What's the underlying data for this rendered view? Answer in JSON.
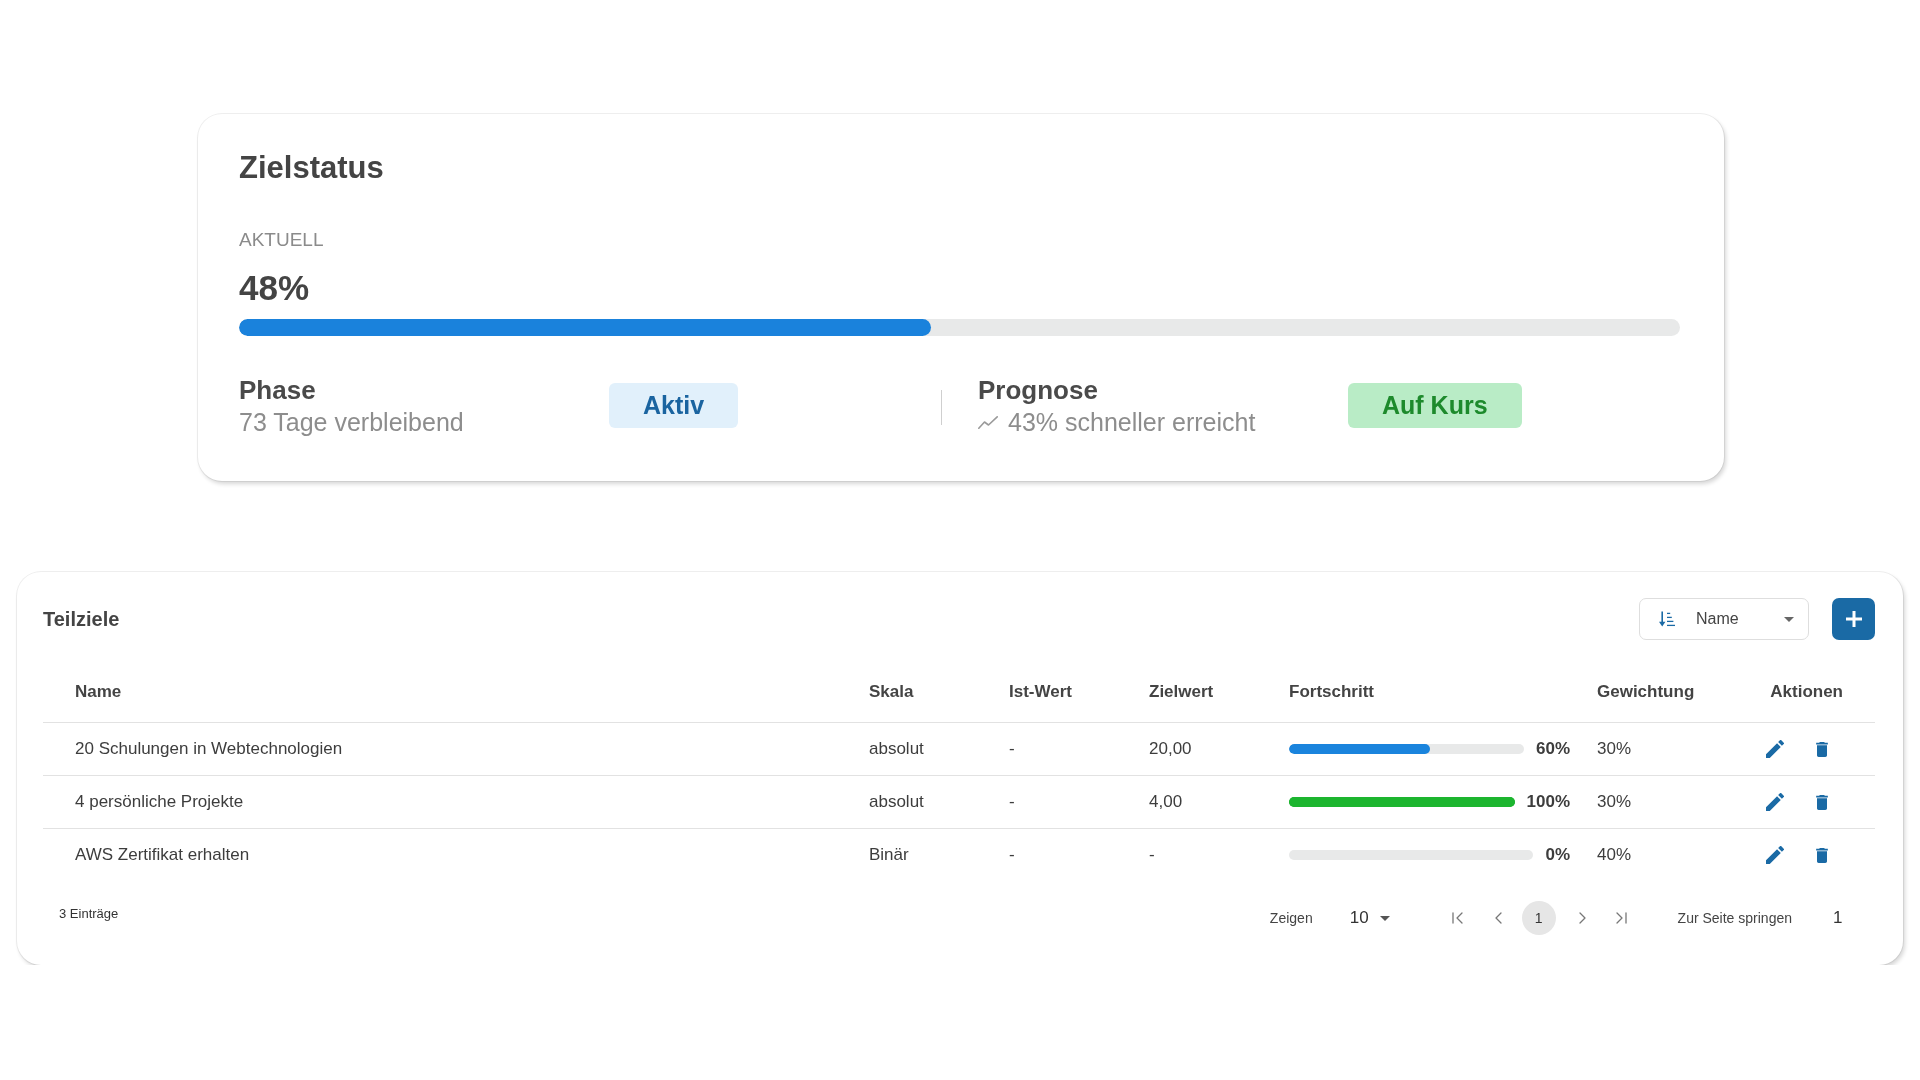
{
  "goal_status": {
    "title": "Zielstatus",
    "current": {
      "label": "AKTUELL",
      "value": "48%",
      "level": 0.48
    },
    "phase": {
      "label": "Phase",
      "detail": "73 Tage verbleibend",
      "badge": {
        "kind": "info",
        "text": "Aktiv"
      }
    },
    "forecast": {
      "label": "Prognose",
      "detail": "43% schneller erreicht",
      "badge": {
        "kind": "success",
        "text": "Auf Kurs"
      }
    }
  },
  "subgoals": {
    "title": "Teilziele",
    "sort": {
      "value": "Name"
    },
    "table": {
      "columns": [
        "Name",
        "Skala",
        "Ist-Wert",
        "Zielwert",
        "Fortschritt",
        "Gewichtung",
        "Aktionen"
      ],
      "rows": [
        {
          "name": "20 Schulungen in Webtechnologien",
          "scale": "absolut",
          "actual": "-",
          "target": "20,00",
          "progress": {
            "level": 0.6,
            "reading": "60%",
            "color": "#1a84dd"
          },
          "weight": "30%"
        },
        {
          "name": "4 persönliche Projekte",
          "scale": "absolut",
          "actual": "-",
          "target": "4,00",
          "progress": {
            "level": 1,
            "reading": "100%",
            "color": "#1cb52f"
          },
          "weight": "30%"
        },
        {
          "name": "AWS Zertifikat erhalten",
          "scale": "Binär",
          "actual": "-",
          "target": "-",
          "progress": {
            "level": 0,
            "reading": "0%"
          },
          "weight": "40%"
        }
      ]
    },
    "footer": {
      "count": "3 Einträge",
      "page_size_label": "Zeigen",
      "page_size": "10",
      "pages": [
        {
          "label": "1",
          "selected": true
        }
      ],
      "jump_label": "Zur Seite springen",
      "jump_value": "1"
    }
  }
}
